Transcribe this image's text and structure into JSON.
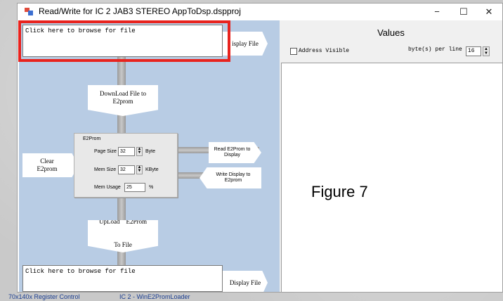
{
  "window": {
    "title": "Read/Write for IC 2 JAB3 STEREO AppToDsp.dspproj",
    "minimize": "−",
    "maximize": "☐",
    "close": "✕"
  },
  "left": {
    "browse_top_text": "Click here to browse for file",
    "display_file_top": "isplay File",
    "download_line1": "DownLoad File to",
    "download_line2": "E2prom",
    "clear_line1": "Clear",
    "clear_line2": "E2prom",
    "e2prom": {
      "group_title": "E2Prom",
      "page_size_label": "Page Size",
      "page_size_value": "32",
      "page_size_unit": "Byte",
      "mem_size_label": "Mem Size",
      "mem_size_value": "32",
      "mem_size_unit": "KByte",
      "mem_usage_label": "Mem Usage",
      "mem_usage_value": "25",
      "mem_usage_unit": "%"
    },
    "read_line1": "Read E2Prom to",
    "read_line2": "Display",
    "write_line1": "Write Display to",
    "write_line2": "E2prom",
    "upload_line1": "UpLoad    E2Prom",
    "upload_line2": "To File",
    "browse_bottom_text": "Click here to browse for file",
    "display_file_bottom": "Display File"
  },
  "right": {
    "values_title": "Values",
    "address_visible_label": "Address Visible",
    "bytes_per_line_label": "byte(s) per line",
    "bytes_per_line_value": "16",
    "figure_label": "Figure 7"
  },
  "taskbar": {
    "tab1": "70x140x Register Control",
    "tab2": "IC 2 - WinE2PromLoader"
  },
  "colors": {
    "left_panel": "#b8cce4",
    "highlight": "#e8231e"
  }
}
